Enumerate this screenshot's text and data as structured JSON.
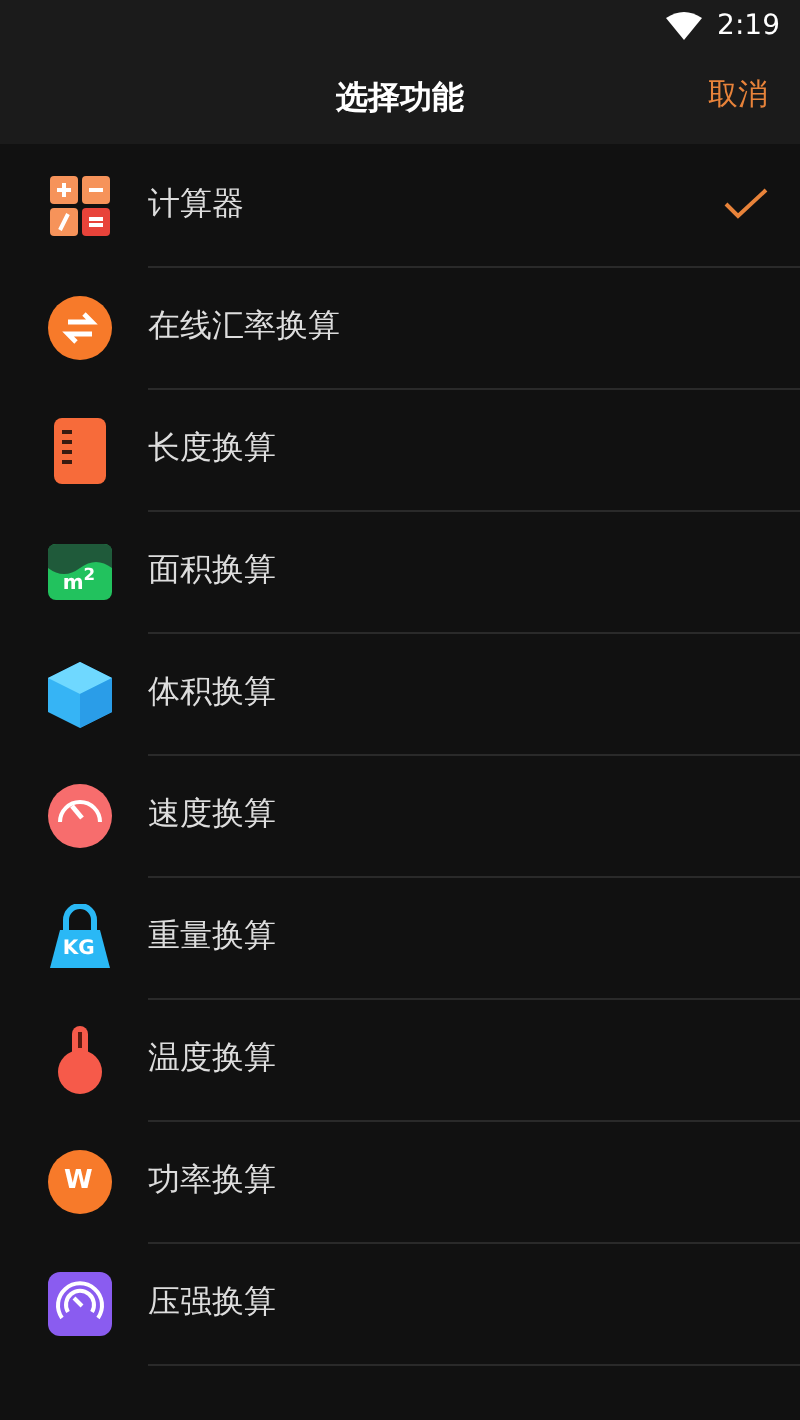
{
  "status_bar": {
    "time": "2:19"
  },
  "header": {
    "title": "选择功能",
    "cancel": "取消"
  },
  "items": [
    {
      "label": "计算器",
      "kind": "calculator",
      "selected": true
    },
    {
      "label": "在线汇率换算",
      "kind": "exchange",
      "selected": false
    },
    {
      "label": "长度换算",
      "kind": "ruler",
      "selected": false
    },
    {
      "label": "面积换算",
      "kind": "area",
      "icon_label": "m$^{2}$",
      "selected": false
    },
    {
      "label": "体积换算",
      "kind": "cube",
      "selected": false
    },
    {
      "label": "速度换算",
      "kind": "speed",
      "selected": false
    },
    {
      "label": "重量换算",
      "kind": "weight",
      "icon_label": "KG",
      "selected": false
    },
    {
      "label": "温度换算",
      "kind": "thermometer",
      "selected": false
    },
    {
      "label": "功率换算",
      "kind": "power",
      "icon_label": "W",
      "selected": false
    },
    {
      "label": "压强换算",
      "kind": "gauge",
      "selected": false
    }
  ]
}
